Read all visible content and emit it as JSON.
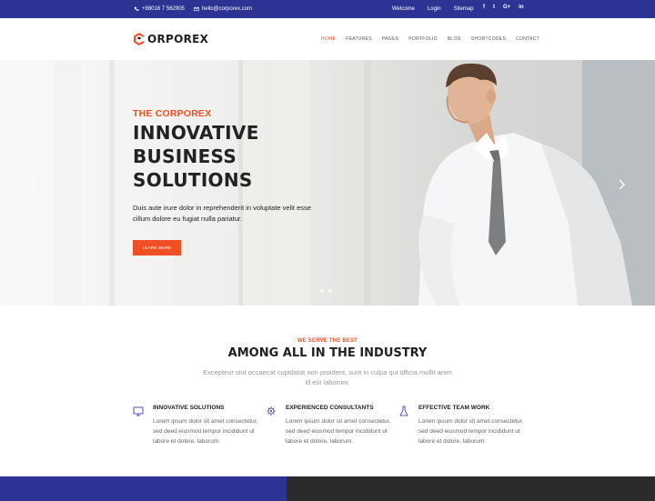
{
  "topbar": {
    "phone": "+88016 7 562905",
    "email": "hello@corporex.com",
    "links": [
      "Welcome",
      "Login",
      "Sitemap"
    ],
    "social": [
      "f",
      "t",
      "G+",
      "in"
    ]
  },
  "header": {
    "logo_text": "ORPOREX",
    "nav": [
      "HOME",
      "FEATURES",
      "PAGES",
      "PORTFOLIO",
      "BLOG",
      "SHORTCODES",
      "CONTACT"
    ],
    "active_nav": "HOME"
  },
  "hero": {
    "kicker": "THE CORPOREX",
    "title_lines": [
      "INNOVATIVE",
      "BUSINESS",
      "SOLUTIONS"
    ],
    "text": "Duis aute irure dolor in reprehenderit in voluptate velit esse cillum dolore eu fugiat nulla pariatur.",
    "button": "LEARN MORE"
  },
  "features": {
    "kicker": "WE SERVE THE BEST",
    "title": "AMONG ALL IN THE INDUSTRY",
    "desc": "Excepteur sint occaecat cupidatat non proident, sunt in culpa qui officia mollit anim id est laborum.",
    "items": [
      {
        "title": "INNOVATIVE SOLUTIONS",
        "text": "Lorem ipsum dolor sit amet consectetur, sed deed eiusmod tempor incididunt ut labore et dolore, laborum."
      },
      {
        "title": "EXPERIENCED CONSULTANTS",
        "text": "Lorem ipsum dolor sit amet consectetur, sed deed eiusmod tempor incididunt ut labore et dolore, laborum."
      },
      {
        "title": "EFFECTIVE TEAM WORK",
        "text": "Lorem ipsum dolor sit amet consectetur, sed deed eiusmod tempor incididunt ut labore et dolore, laborum."
      }
    ]
  },
  "colors": {
    "accent": "#f04e23",
    "brand": "#2c3393",
    "dark": "#2b2b2b"
  }
}
